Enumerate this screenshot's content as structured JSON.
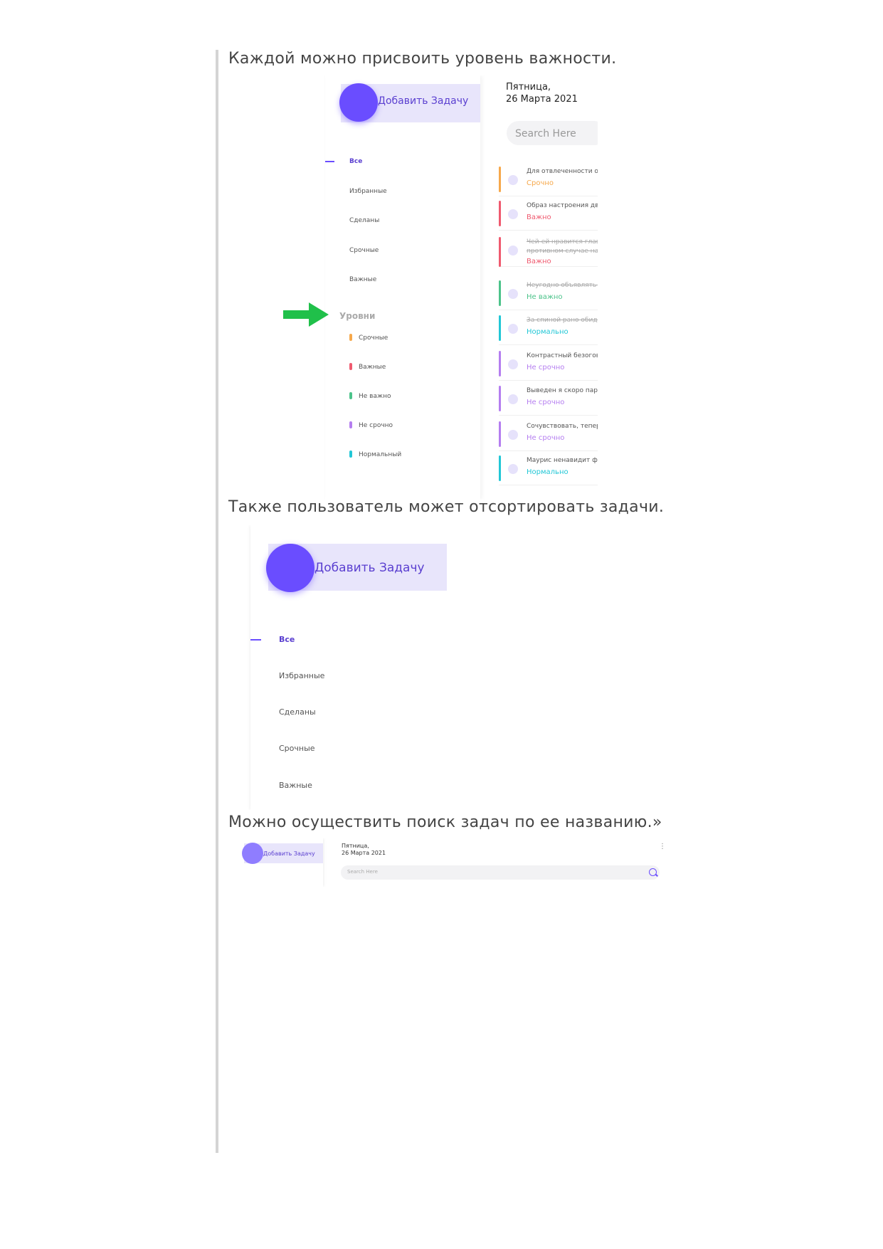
{
  "document": {
    "caption1": "Каждой можно присвоить уровень важности.",
    "caption2": "Также пользователь может отсортировать задачи.",
    "caption3": "Можно осуществить поиск задач по ее названию.»"
  },
  "shot1": {
    "add_task_label": "Добавить Задачу",
    "date_line1": "Пятница,",
    "date_line2": "26 Марта 2021",
    "search_placeholder": "Search Here",
    "nav": [
      "Все",
      "Избранные",
      "Сделаны",
      "Срочные",
      "Важные"
    ],
    "levels_title": "Уровни",
    "levels": [
      {
        "label": "Срочные",
        "color": "#f6a84b"
      },
      {
        "label": "Важные",
        "color": "#ef5a6f"
      },
      {
        "label": "Не важно",
        "color": "#4cc38a"
      },
      {
        "label": "Не срочно",
        "color": "#b57ef0"
      },
      {
        "label": "Нормальный",
        "color": "#22c7d6"
      }
    ],
    "tasks": [
      {
        "text": "Для отвлеченности очар",
        "level": "Срочно",
        "color": "#f6a84b",
        "done": false
      },
      {
        "text": "Образ настроения двух с",
        "level": "Важно",
        "color": "#ef5a6f",
        "done": false
      },
      {
        "text": "Чей-ей нравится главны",
        "text2": "противном случае нали",
        "level": "Важно",
        "color": "#ef5a6f",
        "done": true
      },
      {
        "text": "Неугодно объявлять себ",
        "level": "Не важно",
        "color": "#4cc38a",
        "done": true
      },
      {
        "text": "За спиной рано обидать",
        "level": "Нормально",
        "color": "#22c7d6",
        "done": true
      },
      {
        "text": "Контрастный безоговор",
        "level": "Не срочно",
        "color": "#b57ef0",
        "done": false
      },
      {
        "text": "Выведен я скоро парк м",
        "level": "Не срочно",
        "color": "#b57ef0",
        "done": false
      },
      {
        "text": "Сочувствовать, теперь п",
        "level": "Не срочно",
        "color": "#b57ef0",
        "done": false
      },
      {
        "text": "Маурис ненавидит футб",
        "level": "Нормально",
        "color": "#22c7d6",
        "done": false
      }
    ]
  },
  "shot2": {
    "add_task_label": "Добавить Задачу",
    "nav": [
      "Все",
      "Избранные",
      "Сделаны",
      "Срочные",
      "Важные"
    ]
  },
  "shot3": {
    "add_task_label": "Добавить Задачу",
    "date_line1": "Пятница,",
    "date_line2": "26 Марта 2021",
    "search_placeholder": "Search Here"
  },
  "colors": {
    "accent": "#6a4dff",
    "accent_light": "#e8e5fb",
    "arrow": "#20c04a"
  }
}
